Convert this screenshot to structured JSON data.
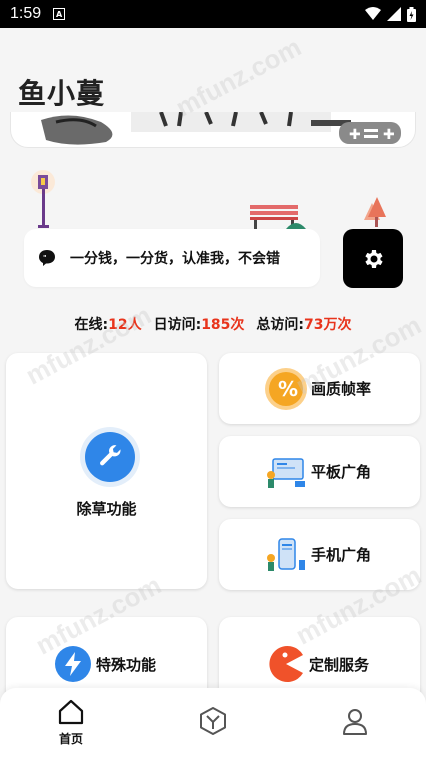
{
  "status_bar": {
    "time": "1:59",
    "notification_glyph": "A",
    "icons": [
      "wifi-icon",
      "signal-icon",
      "battery-icon"
    ]
  },
  "app": {
    "title": "鱼小蔓"
  },
  "quote": {
    "text": "一分钱，一分货，认准我，不会错"
  },
  "stats": {
    "online_label": "在线:",
    "online_value": "12人",
    "daily_label": "日访问:",
    "daily_value": "185次",
    "total_label": "总访问:",
    "total_value": "73万次"
  },
  "features": {
    "weed_removal": "除草功能",
    "quality_fps": "画质帧率",
    "tablet_wide": "平板广角",
    "phone_wide": "手机广角",
    "special": "特殊功能",
    "custom_service": "定制服务"
  },
  "watermark_text": "mfunz.com",
  "tabbar": {
    "home_label": "首页",
    "active": "home"
  },
  "colors": {
    "accent_red": "#e8341c",
    "blue": "#2f86e8",
    "orange": "#f5a623"
  }
}
